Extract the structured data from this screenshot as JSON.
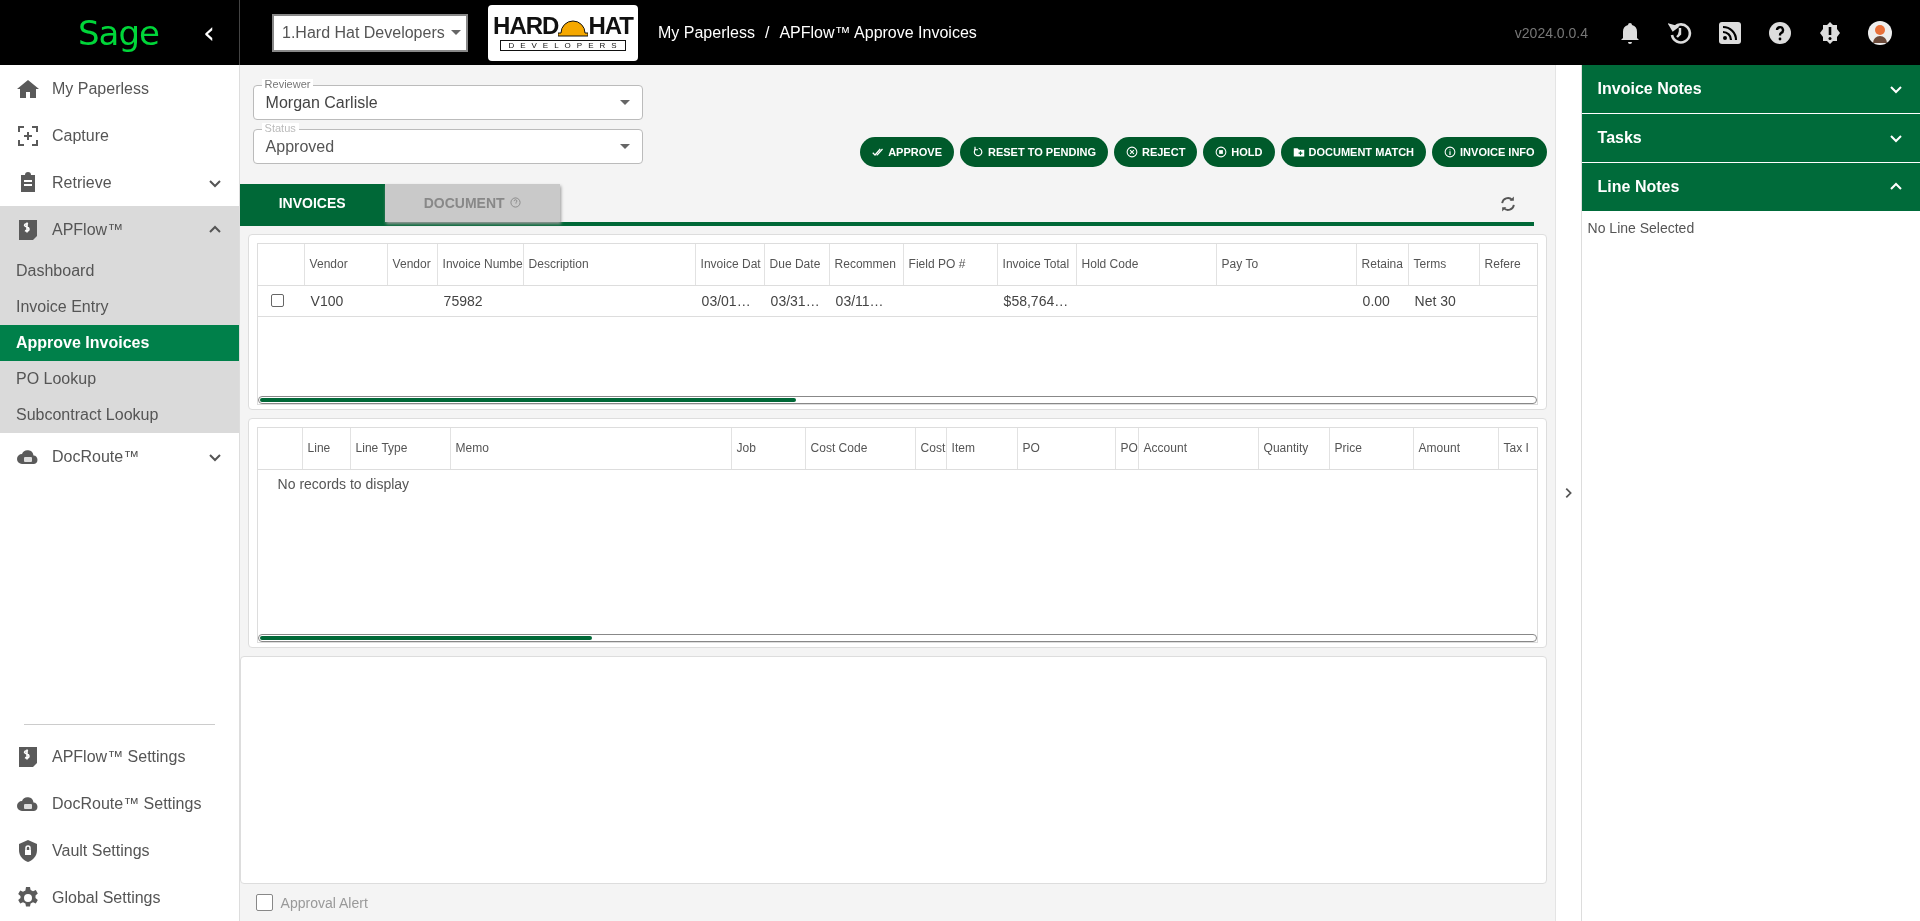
{
  "topbar": {
    "logo": "Sage",
    "collapse": "‹",
    "company": "1.Hard Hat Developers",
    "brand": {
      "word1": "HARD",
      "word2": "HAT",
      "tagline": "DEVELOPERS"
    },
    "breadcrumb": [
      "My Paperless",
      "APFlow™ Approve Invoices"
    ],
    "separator": "/",
    "version": "v2024.0.0.4"
  },
  "sidebar": {
    "items": [
      {
        "kind": "link",
        "label": "My Paperless"
      },
      {
        "kind": "link",
        "label": "Capture"
      },
      {
        "kind": "group",
        "label": "Retrieve",
        "expanded": false
      },
      {
        "kind": "group",
        "label": "APFlow™",
        "expanded": true,
        "children": [
          {
            "label": "Dashboard",
            "selected": false
          },
          {
            "label": "Invoice Entry",
            "selected": false
          },
          {
            "label": "Approve Invoices",
            "selected": true
          },
          {
            "label": "PO Lookup",
            "selected": false
          },
          {
            "label": "Subcontract Lookup",
            "selected": false
          }
        ]
      },
      {
        "kind": "group",
        "label": "DocRoute™",
        "expanded": false
      }
    ],
    "settings": [
      {
        "label": "APFlow™ Settings"
      },
      {
        "label": "DocRoute™ Settings"
      },
      {
        "label": "Vault Settings"
      },
      {
        "label": "Global Settings"
      }
    ]
  },
  "filters": [
    {
      "label": "Reviewer",
      "value": "Morgan Carlisle",
      "disabled": false
    },
    {
      "label": "Status",
      "value": "Approved",
      "disabled": true
    }
  ],
  "actions": [
    {
      "label": "APPROVE"
    },
    {
      "label": "RESET TO PENDING"
    },
    {
      "label": "REJECT"
    },
    {
      "label": "HOLD"
    },
    {
      "label": "DOCUMENT MATCH"
    },
    {
      "label": "INVOICE INFO"
    }
  ],
  "tabs": [
    {
      "label": "INVOICES",
      "selected": true
    },
    {
      "label": "DOCUMENT",
      "selected": false
    }
  ],
  "invoice_table": {
    "columns": [
      "Vendor",
      "Vendor",
      "Invoice Numbe",
      "Description",
      "Invoice Dat",
      "Due Date",
      "Recommen",
      "Field PO #",
      "Invoice Total",
      "Hold Code",
      "Pay To",
      "Retaina",
      "Terms",
      "Refere"
    ],
    "rows": [
      {
        "checked": false,
        "cells": [
          "V100",
          null,
          "75982",
          null,
          "03/01…",
          "03/31…",
          "03/11…",
          null,
          "$58,764…",
          null,
          null,
          "0.00",
          "Net 30",
          null
        ]
      }
    ]
  },
  "line_table": {
    "columns": [
      "Line",
      "Line Type",
      "Memo",
      "Job",
      "Cost Code",
      "Cost",
      "Item",
      "PO",
      "PO",
      "Account",
      "Quantity",
      "Price",
      "Amount",
      "Tax I"
    ],
    "empty_message": "No records to display"
  },
  "approval_alert": {
    "label": "Approval Alert",
    "checked": false
  },
  "right_panel": {
    "sections": [
      {
        "title": "Invoice Notes",
        "expanded": false
      },
      {
        "title": "Tasks",
        "expanded": false
      },
      {
        "title": "Line Notes",
        "expanded": true,
        "body": "No Line Selected"
      }
    ]
  }
}
